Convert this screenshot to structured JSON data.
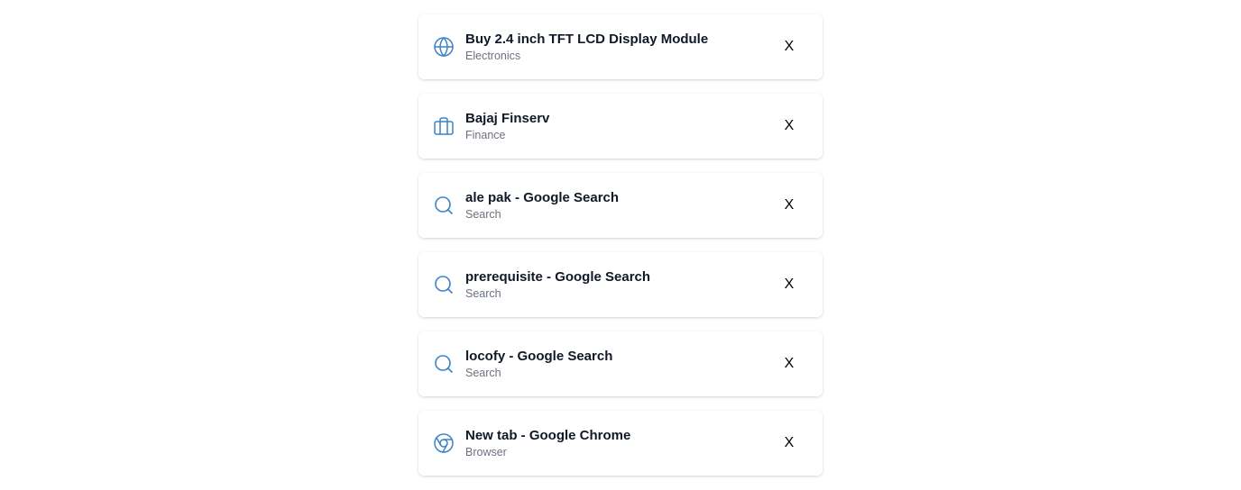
{
  "colors": {
    "icon": "#3b82c8",
    "title": "#111827",
    "category": "#6b7280"
  },
  "items": [
    {
      "title": "Buy 2.4 inch TFT LCD Display Module",
      "category": "Electronics",
      "icon": "globe-icon",
      "close_label": "X"
    },
    {
      "title": "Bajaj Finserv",
      "category": "Finance",
      "icon": "briefcase-icon",
      "close_label": "X"
    },
    {
      "title": "ale pak - Google Search",
      "category": "Search",
      "icon": "search-icon",
      "close_label": "X"
    },
    {
      "title": "prerequisite - Google Search",
      "category": "Search",
      "icon": "search-icon",
      "close_label": "X"
    },
    {
      "title": "locofy - Google Search",
      "category": "Search",
      "icon": "search-icon",
      "close_label": "X"
    },
    {
      "title": "New tab - Google Chrome",
      "category": "Browser",
      "icon": "chrome-icon",
      "close_label": "X"
    }
  ]
}
